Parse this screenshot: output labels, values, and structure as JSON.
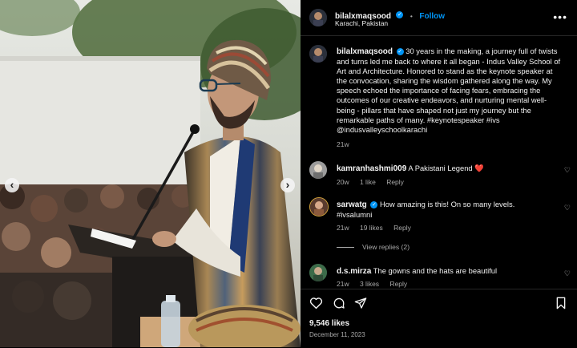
{
  "post": {
    "author": "bilalxmaqsood",
    "follow_label": "Follow",
    "dot": "•",
    "location": "Karachi, Pakistan",
    "more_label": "•••",
    "caption": "30 years in the making, a journey full of twists and turns led me back to where it all began - Indus Valley School of Art and Architecture. Honored to stand as the keynote speaker at the convocation, sharing the wisdom gathered along the way. My speech echoed the importance of facing fears, embracing the outcomes of our creative endeavors, and nurturing mental well-being - pillars that have shaped not just my journey but the remarkable paths of many. #keynotespeaker #ivs @indusvalleyschoolkarachi",
    "caption_time": "21w",
    "likes": "9,546 likes",
    "date": "December 11, 2023"
  },
  "comments": [
    {
      "user": "kamranhashmi009",
      "text": "A Pakistani Legend",
      "emoji": "❤️",
      "time": "20w",
      "likes": "1 like",
      "reply": "Reply",
      "verified": false
    },
    {
      "user": "sarwatg",
      "text": "How amazing is this! On so many levels. #ivsalumni",
      "time": "21w",
      "likes": "19 likes",
      "reply": "Reply",
      "verified": true
    },
    {
      "user": "d.s.mirza",
      "text": "The gowns and the hats are beautiful",
      "time": "21w",
      "likes": "3 likes",
      "reply": "Reply",
      "verified": false
    }
  ],
  "view_replies": "View replies (2)",
  "icons": {
    "like": "heart-icon",
    "comment": "comment-icon",
    "share": "share-icon",
    "save": "bookmark-icon",
    "nav_prev": "chevron-left-icon",
    "nav_next": "chevron-right-icon"
  },
  "colors": {
    "accent": "#0095f6",
    "background": "#000000",
    "muted": "#a8a8a8"
  }
}
